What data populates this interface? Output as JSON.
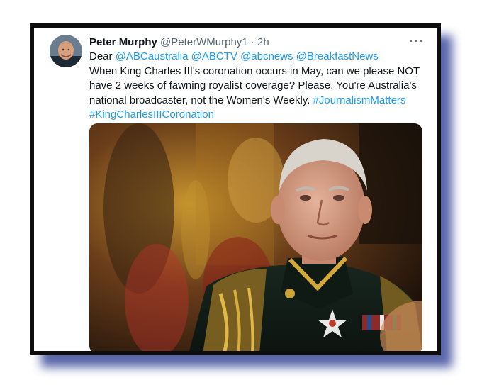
{
  "tweet": {
    "display_name": "Peter Murphy",
    "handle": "@PeterWMurphy1",
    "separator": "·",
    "time": "2h",
    "more": "···",
    "greeting": "Dear",
    "mentions": [
      "@ABCaustralia",
      "@ABCTV",
      "@abcnews",
      "@BreakfastNews"
    ],
    "body_line_1": "When King Charles III's coronation occurs in May, can we please NOT",
    "body_line_2": "have 2 weeks of fawning royalist coverage? Please. You're Australia's",
    "body_line_3": "national broadcaster, not the Women's Weekly.",
    "hashtags": [
      "#JournalismMatters",
      "#KingCharlesIIICoronation"
    ]
  },
  "colors": {
    "link": "#1d9bf0",
    "text": "#0f1419",
    "muted": "#536471",
    "frame": "#0d0d0d",
    "shadow": "#3b4a9a"
  },
  "icons": {
    "more": "more-horizontal-icon"
  }
}
